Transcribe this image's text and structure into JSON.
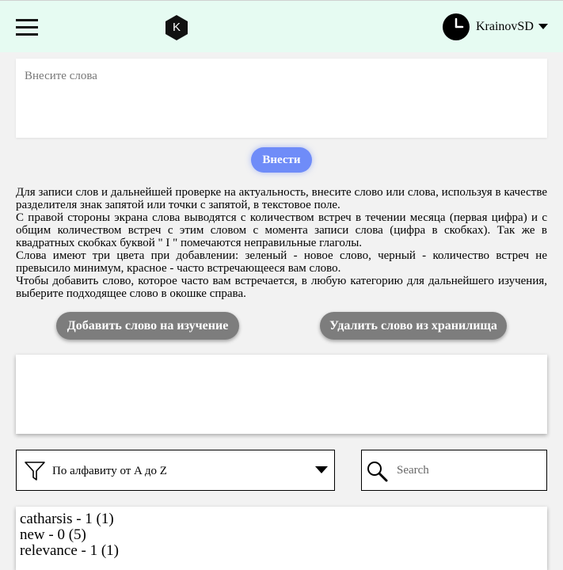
{
  "header": {
    "logo_letter": "K",
    "username": "KrainovSD",
    "background": "#e6fbf2"
  },
  "icons": {
    "menu": "hamburger-menu-icon",
    "logo": "hexagon-logo-icon",
    "avatar": "clock-avatar-icon",
    "user_menu": "caret-down-icon",
    "filter": "funnel-filter-icon",
    "sort_toggle": "triangle-down-icon",
    "search": "magnifier-search-icon"
  },
  "word_input": {
    "placeholder": "Внесите слова",
    "value": ""
  },
  "submit_label": "Внести",
  "info": {
    "p1": "Для записи слов и дальнейшей проверке на актуальность, внесите слово или слова, используя в качестве разделителя знак запятой или точки с запятой, в текстовое поле.",
    "p2": "С правой стороны экрана слова выводятся с количеством встреч в течении месяца (первая цифра) и с общим количеством встреч с этим словом с момента записи слова (цифра в скобках). Так же в квадратных скобках буквой \" I \" помечаются неправильные глаголы.",
    "p3": "Слова имеют три цвета при добавлении: зеленый - новое слово, черный - количество встреч не превысило минимум, красное - часто встречающееся вам слово.",
    "p4": "Чтобы добавить слово, которое часто вам встречается, в любую категорию для дальнейшего изучения, выберите подходящее слово в окошке справа."
  },
  "actions": {
    "add_label": "Добавить слово на изучение",
    "delete_label": "Удалить слово из хранилища"
  },
  "sort": {
    "selected": "По алфавиту от A до Z"
  },
  "search": {
    "placeholder": "Search",
    "value": ""
  },
  "words": [
    {
      "text": "catharsis - 1 (1)"
    },
    {
      "text": "new - 0 (5)"
    },
    {
      "text": "relevance - 1 (1)"
    }
  ],
  "colors": {
    "accent_button": "#6f8cf8",
    "grey_button": "#7d7d7d",
    "page_background": "#f2f2f2"
  }
}
